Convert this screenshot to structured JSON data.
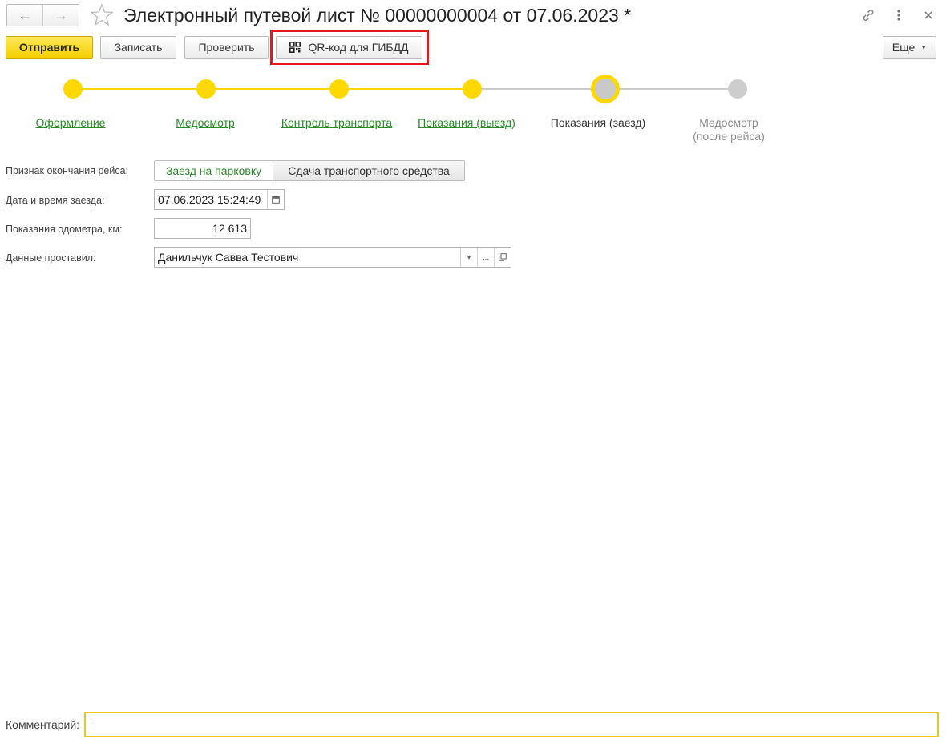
{
  "header": {
    "back_icon": "arrow-left-icon",
    "forward_icon": "arrow-right-icon",
    "favorite_icon": "star-icon",
    "title": "Электронный путевой лист № 00000000004 от 07.06.2023 *",
    "link_icon": "link-icon",
    "more_icon": "more-vertical-icon",
    "close_icon": "close-icon"
  },
  "toolbar": {
    "send_label": "Отправить",
    "save_label": "Записать",
    "check_label": "Проверить",
    "qr_label": "QR-код для ГИБДД",
    "more_label": "Еще"
  },
  "stepper": {
    "steps": [
      {
        "label": "Оформление",
        "state": "done"
      },
      {
        "label": "Медосмотр",
        "state": "done"
      },
      {
        "label": "Контроль транспорта",
        "state": "done"
      },
      {
        "label": "Показания (выезд)",
        "state": "done"
      },
      {
        "label": "Показания (заезд)",
        "state": "current"
      },
      {
        "label": "Медосмотр\n(после рейса)",
        "state": "future"
      }
    ],
    "colors": {
      "done": "#ffd800",
      "future": "#cdcdcd",
      "link": "#2a8a2a"
    }
  },
  "form": {
    "trip_end_label": "Признак окончания рейса:",
    "trip_end_options": [
      "Заезд на парковку",
      "Сдача транспортного средства"
    ],
    "trip_end_selected": "Заезд на парковку",
    "datetime_label": "Дата и время заезда:",
    "datetime_value": "07.06.2023 15:24:49",
    "odometer_label": "Показания одометра, км:",
    "odometer_value": "12 613",
    "entered_by_label": "Данные проставил:",
    "entered_by_value": "Данильчук Савва Тестович",
    "open_button_text": "..."
  },
  "footer": {
    "comment_label": "Комментарий:",
    "comment_value": ""
  },
  "colors": {
    "primary_button": "#f5cf00",
    "highlight_border": "#e8141e",
    "comment_focus": "#f0c419"
  }
}
